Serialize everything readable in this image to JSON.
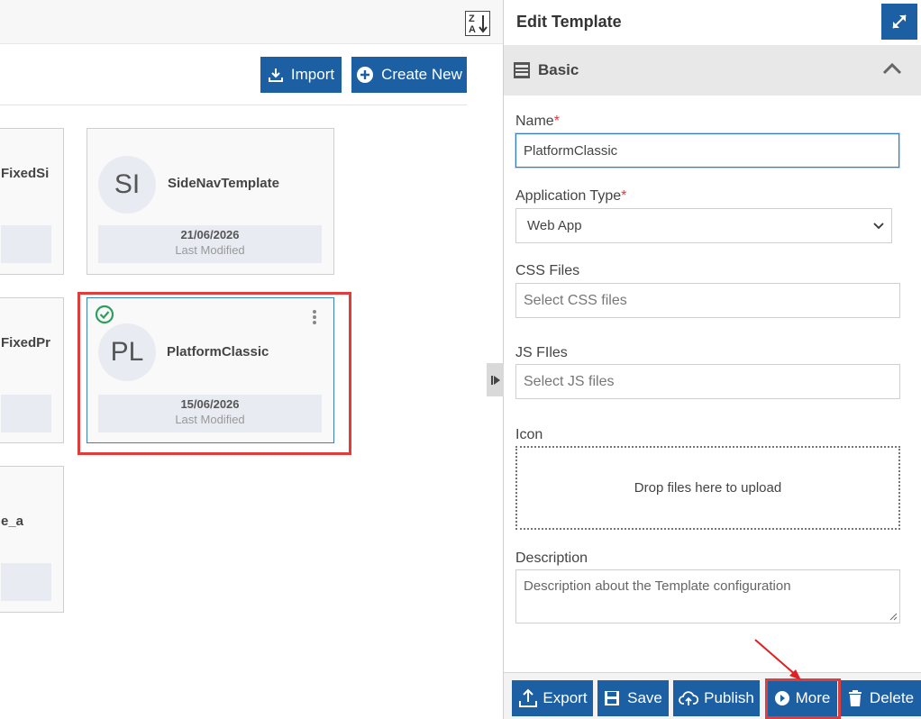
{
  "toolbar": {
    "import_label": "Import",
    "create_label": "Create New"
  },
  "cards": [
    {
      "name": "FixedSi",
      "date": "",
      "lbl": ""
    },
    {
      "initials": "SI",
      "name": "SideNavTemplate",
      "date": "21/06/2026",
      "lbl": "Last Modified"
    },
    {
      "name": "FixedPr",
      "date": "",
      "lbl": ""
    },
    {
      "initials": "PL",
      "name": "PlatformClassic",
      "date": "15/06/2026",
      "lbl": "Last Modified"
    },
    {
      "name": "e_a",
      "date": "",
      "lbl": ""
    }
  ],
  "panel": {
    "title": "Edit Template",
    "section": "Basic",
    "name_label": "Name",
    "name_value": "PlatformClassic",
    "apptype_label": "Application Type",
    "apptype_value": "Web App",
    "css_label": "CSS Files",
    "css_placeholder": "Select CSS files",
    "js_label": "JS FIles",
    "js_placeholder": "Select JS files",
    "icon_label": "Icon",
    "drop_text": "Drop files here to upload",
    "desc_label": "Description",
    "desc_placeholder": "Description about the Template configuration",
    "required_mark": "*"
  },
  "footer": {
    "export": "Export",
    "save": "Save",
    "publish": "Publish",
    "more": "More",
    "delete": "Delete"
  },
  "colors": {
    "primary": "#1d5fa3",
    "highlight": "#e03c3c",
    "check": "#2e9e5b"
  }
}
